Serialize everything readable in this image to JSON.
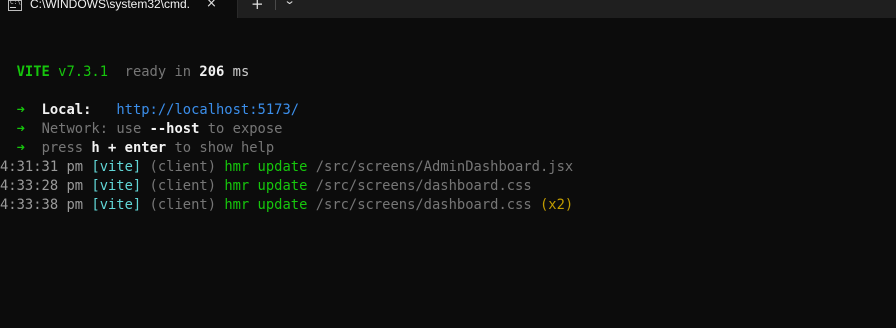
{
  "window": {
    "tab_title": "C:\\WINDOWS\\system32\\cmd.",
    "close_glyph": "×",
    "new_tab_glyph": "+",
    "dropdown_glyph": "⌄"
  },
  "terminal": {
    "banner": {
      "name": "VITE",
      "version": "v7.3.1",
      "ready_text": "ready in",
      "time_value": "206",
      "time_unit": "ms"
    },
    "local": {
      "arrow": "➜",
      "label": "Local:",
      "url": "http://localhost:5173/"
    },
    "network": {
      "arrow": "➜",
      "label": "Network:",
      "use": "use",
      "flag": "--host",
      "rest": "to expose"
    },
    "help": {
      "arrow": "➜",
      "press": "press",
      "key": "h + enter",
      "rest": "to show help"
    },
    "logs": [
      {
        "time": "4:31:31 pm",
        "tag": "[vite]",
        "source": "(client)",
        "action": "hmr update",
        "path": "/src/screens/AdminDashboard.jsx",
        "count": ""
      },
      {
        "time": "4:33:28 pm",
        "tag": "[vite]",
        "source": "(client)",
        "action": "hmr update",
        "path": "/src/screens/dashboard.css",
        "count": ""
      },
      {
        "time": "4:33:38 pm",
        "tag": "[vite]",
        "source": "(client)",
        "action": "hmr update",
        "path": "/src/screens/dashboard.css",
        "count": "(x2)"
      }
    ]
  },
  "colors": {
    "background": "#0c0c0c",
    "green": "#16c60c",
    "cyan": "#61d6d6",
    "link": "#3b8eea",
    "yellow": "#c19c00",
    "gray": "#767676"
  },
  "icons": {
    "tab_icon": "cmd-icon",
    "close": "close-icon",
    "new_tab": "plus-icon",
    "dropdown": "chevron-down-icon"
  }
}
